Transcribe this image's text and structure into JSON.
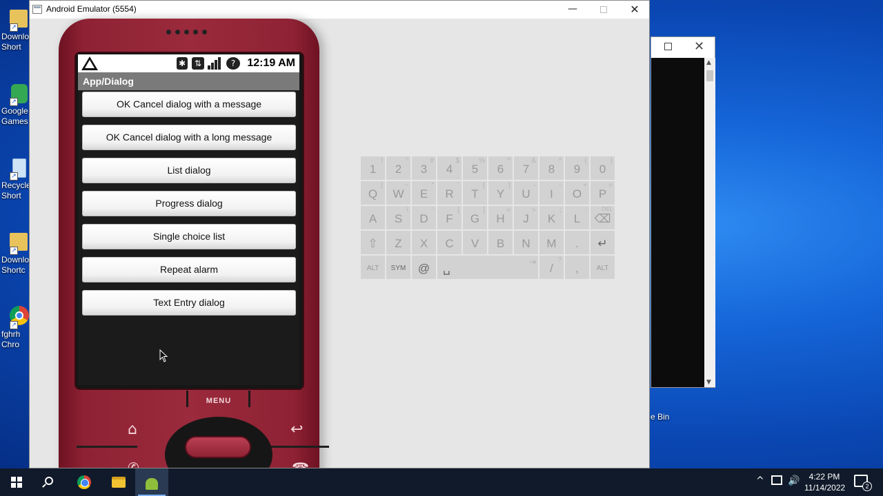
{
  "desktop": {
    "icons": [
      {
        "label": "Downlo",
        "label2": "Short",
        "icon": "folder-icon"
      },
      {
        "label": "Google",
        "label2": "Games",
        "icon": "google-games-icon"
      },
      {
        "label": "Recycle",
        "label2": "Short",
        "icon": "recycle-bin-icon"
      },
      {
        "label": "Downlo",
        "label2": "Shortc",
        "icon": "folder-icon"
      },
      {
        "label": "fghrh",
        "label2": "Chro",
        "icon": "chrome-icon"
      }
    ],
    "bin_label": "e Bin"
  },
  "emulator": {
    "title": "Android Emulator (5554)",
    "controls": {
      "minimize": "—",
      "close": "✕"
    }
  },
  "phone": {
    "status_bar": {
      "time": "12:19 AM",
      "icons": [
        "warning-icon",
        "bluetooth-icon",
        "data-icon",
        "signal-icon",
        "no-sim-icon"
      ],
      "bluetooth_glyph": "✱",
      "data_glyph": "⇅",
      "nosim_glyph": "?"
    },
    "app_title": "App/Dialog",
    "buttons": [
      "OK Cancel dialog with a message",
      "OK Cancel dialog with a long message",
      "List dialog",
      "Progress dialog",
      "Single choice list",
      "Repeat alarm",
      "Text Entry dialog"
    ],
    "menu_label": "MENU",
    "home_glyph": "⌂",
    "back_glyph": "↩",
    "call_glyph": "✆",
    "end_glyph": "☎"
  },
  "keyboard": {
    "rows": [
      [
        {
          "k": "1",
          "a": "!"
        },
        {
          "k": "2",
          "a": "\""
        },
        {
          "k": "3",
          "a": "#"
        },
        {
          "k": "4",
          "a": "$"
        },
        {
          "k": "5",
          "a": "%"
        },
        {
          "k": "6",
          "a": "^"
        },
        {
          "k": "7",
          "a": "&"
        },
        {
          "k": "8",
          "a": "*"
        },
        {
          "k": "9",
          "a": "("
        },
        {
          "k": "0",
          "a": ")"
        }
      ],
      [
        {
          "k": "Q",
          "a": "|"
        },
        {
          "k": "W",
          "a": "~"
        },
        {
          "k": "E",
          "a": "\""
        },
        {
          "k": "R",
          "a": "`"
        },
        {
          "k": "T",
          "a": "{"
        },
        {
          "k": "Y",
          "a": "}"
        },
        {
          "k": "U",
          "a": "-"
        },
        {
          "k": "I",
          "a": "-"
        },
        {
          "k": "O",
          "a": "+"
        },
        {
          "k": "P",
          "a": "="
        }
      ],
      [
        {
          "k": "A",
          "a": ""
        },
        {
          "k": "S",
          "a": "\\"
        },
        {
          "k": "D",
          "a": "'"
        },
        {
          "k": "F",
          "a": "["
        },
        {
          "k": "G",
          "a": "]"
        },
        {
          "k": "H",
          "a": "<"
        },
        {
          "k": "J",
          "a": ">"
        },
        {
          "k": "K",
          "a": ";"
        },
        {
          "k": "L",
          "a": ":"
        },
        {
          "k": "⌫",
          "a": "DEL"
        }
      ],
      [
        {
          "k": "⇧",
          "a": ""
        },
        {
          "k": "Z",
          "a": ""
        },
        {
          "k": "X",
          "a": ""
        },
        {
          "k": "C",
          "a": ""
        },
        {
          "k": "V",
          "a": ""
        },
        {
          "k": "B",
          "a": ""
        },
        {
          "k": "N",
          "a": ""
        },
        {
          "k": "M",
          "a": ""
        },
        {
          "k": ".",
          "a": ""
        },
        {
          "k": "↵",
          "a": ""
        }
      ],
      [
        {
          "k": "ALT",
          "a": ""
        },
        {
          "k": "SYM",
          "a": ""
        },
        {
          "k": "@",
          "a": ""
        },
        {
          "k": "␣",
          "a": "⇥"
        },
        {
          "k": "/",
          "a": "?"
        },
        {
          "k": ",",
          "a": ""
        },
        {
          "k": "ALT",
          "a": ""
        }
      ]
    ]
  },
  "taskbar": {
    "time": "4:22 PM",
    "date": "11/14/2022",
    "notification_count": "2",
    "chevron": "^",
    "volume": "🔊"
  }
}
